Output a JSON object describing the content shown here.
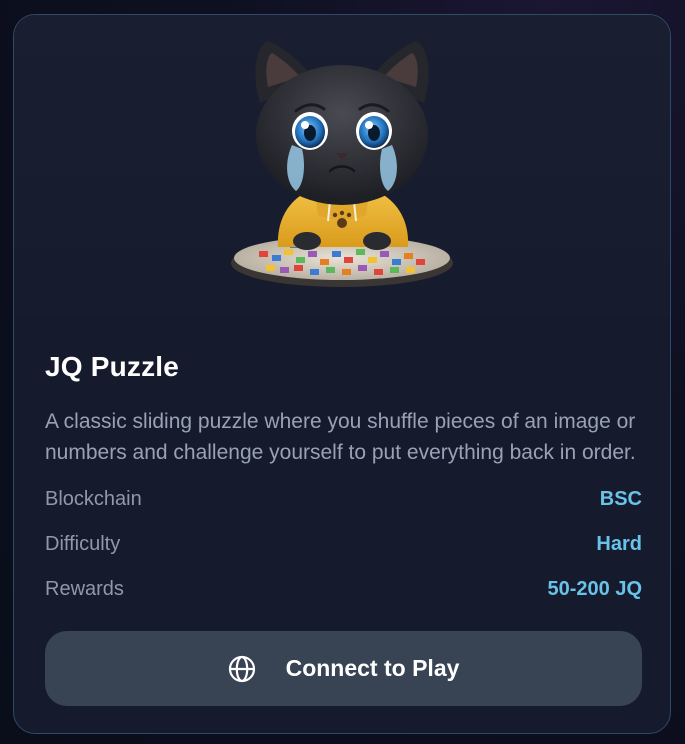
{
  "game": {
    "title": "JQ Puzzle",
    "description": "A classic sliding puzzle where you shuffle pieces of an image or numbers and challenge yourself to put everything back in order.",
    "image_alt": "sad black kitten in a yellow hoodie with a puzzle"
  },
  "details": [
    {
      "label": "Blockchain",
      "value": "BSC"
    },
    {
      "label": "Difficulty",
      "value": "Hard"
    },
    {
      "label": "Rewards",
      "value": "50-200 JQ"
    }
  ],
  "action": {
    "label": "Connect to Play",
    "icon": "globe-icon"
  },
  "colors": {
    "card_background": "#151b2c",
    "card_border": "#2f4a66",
    "value_accent": "#69c2e8",
    "button_background": "#384354"
  }
}
